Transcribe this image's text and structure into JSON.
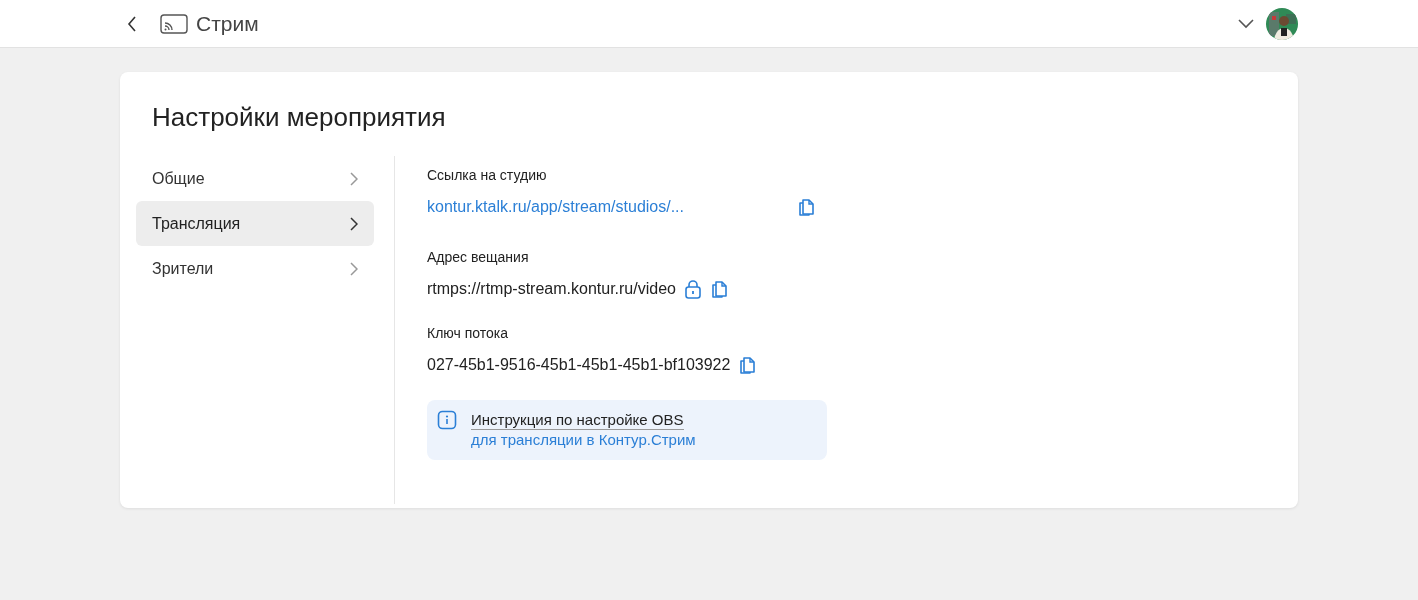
{
  "header": {
    "title": "Стрим"
  },
  "page": {
    "title": "Настройки мероприятия"
  },
  "sidebar": {
    "items": [
      {
        "label": "Общие",
        "selected": false
      },
      {
        "label": "Трансляция",
        "selected": true
      },
      {
        "label": "Зрители",
        "selected": false
      }
    ]
  },
  "fields": [
    {
      "label": "Ссылка на студию",
      "value": "kontur.ktalk.ru/app/stream/studios/...",
      "kind": "link",
      "locked": false
    },
    {
      "label": "Адрес вещания",
      "value": "rtmps://rtmp-stream.kontur.ru/video",
      "kind": "text",
      "locked": true
    },
    {
      "label": "Ключ потока",
      "value": "027-45b1-9516-45b1-45b1-45b1-bf103922",
      "kind": "text",
      "locked": false
    }
  ],
  "info": {
    "title": "Инструкция по настройке OBS",
    "subtitle": "для трансляции в Контур.Стрим"
  }
}
